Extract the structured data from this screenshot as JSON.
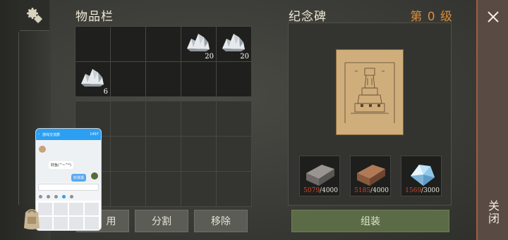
{
  "inventory": {
    "title": "物品栏",
    "slots": [
      {
        "item": "",
        "count": ""
      },
      {
        "item": "",
        "count": ""
      },
      {
        "item": "",
        "count": ""
      },
      {
        "item": "stone-pile",
        "count": "20"
      },
      {
        "item": "stone-pile",
        "count": "20"
      },
      {
        "item": "stone-pile",
        "count": "6"
      },
      {
        "item": "",
        "count": ""
      },
      {
        "item": "",
        "count": ""
      },
      {
        "item": "",
        "count": ""
      },
      {
        "item": "",
        "count": ""
      }
    ],
    "buttons": {
      "use": "用",
      "split": "分割",
      "remove": "移除"
    }
  },
  "monument": {
    "title": "纪念碑",
    "level": "第 0 级",
    "materials": [
      {
        "name": "stone-block",
        "have": "5079",
        "need": "4000"
      },
      {
        "name": "clay-brick",
        "have": "5185",
        "need": "4000"
      },
      {
        "name": "crystal",
        "have": "1569",
        "need": "3000"
      }
    ],
    "assemble_label": "组装"
  },
  "close": {
    "label": "关闭"
  },
  "chat": {
    "header": "游戏交流群",
    "header_count": "1497",
    "msg_left": "财鱼(^~^*)",
    "msg_right": "好滋滋"
  },
  "colors": {
    "level_orange": "#d98c3a",
    "shortage_red": "#d6452e",
    "close_border": "#a05c47"
  }
}
